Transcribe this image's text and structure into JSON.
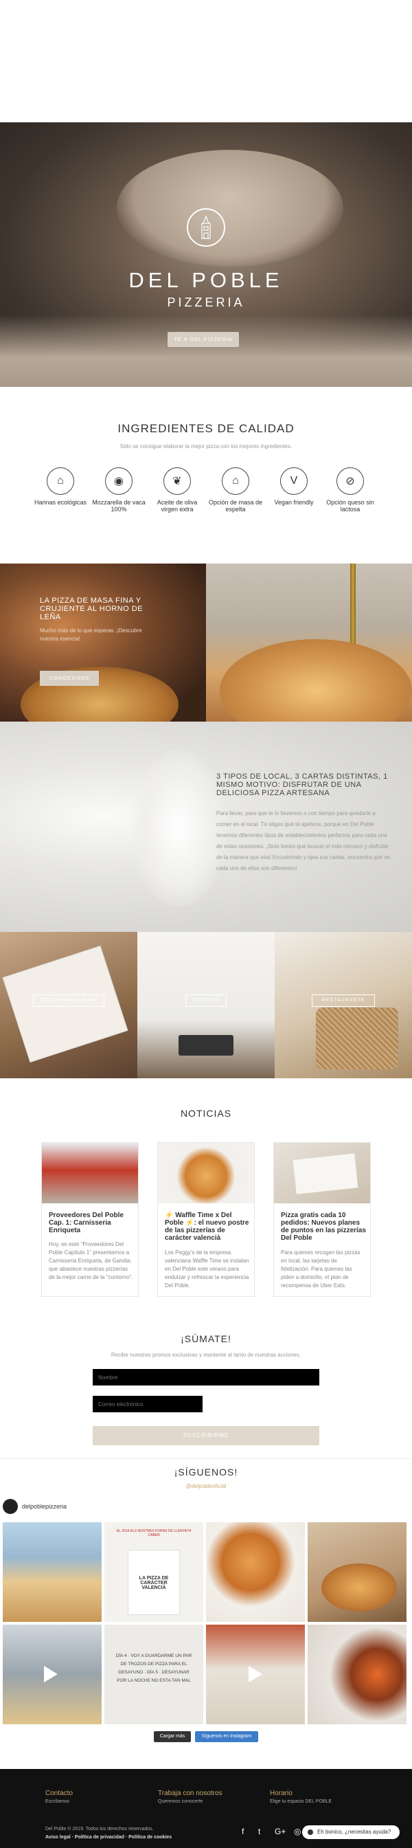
{
  "hero": {
    "brand_title": "DEL POBLE",
    "brand_subtitle": "PIZZERIA",
    "button": "TE A DEL PIZZERIA"
  },
  "ingredients": {
    "title": "INGREDIENTES DE CALIDAD",
    "subtitle": "Sólo se consigue elaborar la mejor pizza con los mejores ingredientes.",
    "items": [
      {
        "icon": "flour-sack-icon",
        "label": "Harinas ecológicas"
      },
      {
        "icon": "mozzarella-icon",
        "label": "Mozzarella de vaca 100%"
      },
      {
        "icon": "olive-icon",
        "label": "Aceite de oliva virgen extra"
      },
      {
        "icon": "spelt-dough-icon",
        "label": "Opción de masa de espelta"
      },
      {
        "icon": "vegan-icon",
        "label": "Vegan friendly"
      },
      {
        "icon": "lactose-free-icon",
        "label": "Opción queso sin lactosa"
      }
    ]
  },
  "thin": {
    "title": "LA PIZZA DE MASA FINA Y CRUJIENTE AL HORNO DE LEÑA",
    "text": "Mucho más de lo que esperas. ¡Descubre nuestra esencia!",
    "button": "CONÓCENOS"
  },
  "local": {
    "title": "3 TIPOS DE LOCAL, 3 CARTAS DISTINTAS, 1 MISMO MOTIVO: DISFRUTAR DE UNA DELICIOSA PIZZA ARTESANA",
    "text": "Para llevar, para que te lo llevemos o con tiempo para quedarte a comer en el local. Tú eliges qué te apetece, porque en Del Poble tenemos diferentes tipos de establecimientos perfectos para cada una de estas ocasiones. ¡Solo tienes que buscar el más cercano y disfrutar de la manera que sea! Encuéntralo y ojea sus cartas, encuentra qué en cada uno de ellos son diferentes!"
  },
  "types": [
    "SOLO PARA LLEVAR",
    "PIZZERÍA",
    "RESTAURANTE"
  ],
  "news": {
    "title": "NOTICIAS",
    "cards": [
      {
        "title": "Proveedores Del Poble Cap. 1: Carnisseria Enriqueta",
        "text": "Hoy, en este \"Proveedores Del Poble Capítulo 1\" presentamos a Carnisseria Enriqueta, de Gandia, que abastece nuestras pizzerías de la mejor carne de la \"contorno\"."
      },
      {
        "title": "⚡ Waffle Time x Del Poble ⚡: el nuevo postre de las pizzerías de carácter valencià",
        "text": "Los Peggy's de la empresa valenciana Waffle Time se instalan en Del Poble este verano para endulzar y refrescar la experiencia Del Poble."
      },
      {
        "title": "Pizza gratis cada 10 pedidos: Nuevos planes de puntos en las pizzerías Del Poble",
        "text": "Para quienes recogen las pizzas en local, las tarjetas de fidelización. Para quienes las piden a domicilio, el plan de recompensa de Uber Eats."
      }
    ]
  },
  "signup": {
    "title": "¡SÚMATE!",
    "subtitle": "Recibe nuestras promos exclusivas y mantente al tanto de nuestras acciones.",
    "name_placeholder": "Nombre",
    "email_placeholder": "Correo electrónico",
    "button": "SUSCRIBIRME"
  },
  "follow": {
    "title": "¡SÍGUENOS!",
    "handle": "@delpobleoficial",
    "account": "delpoblepizzeria",
    "post_text": "DÍA 4 · VOY A GUARDARME UN PAR DE TROZOS DE PIZZA PARA EL DESAYUNO · DÍA 5 · DESAYUNAR POR LA NOCHE NO ESTA TAN MAL",
    "promo_text": "EL 2014 ELS NOSTRES FORNS DE LLENYA HI CABEN",
    "bag_text": "LA PIZZA DE CARÁCTER VALENCIÀ",
    "load_more": "Cargar más",
    "follow_btn": "Síguenos en Instagram"
  },
  "footer": {
    "col1_title": "Contacto",
    "col1_text": "Escríbenos",
    "col2_title": "Trabaja con nosotros",
    "col2_text": "Queremos conocerte",
    "col3_title": "Horario",
    "col3_text": "Elige tu espacio DEL POBLE",
    "copyright": "Del Poble © 2019. Todos los derechos reservados.",
    "legal": "Aviso legal · Política de privacidad · Política de cookies",
    "whatsapp": "Eh bonico, ¿necesitas ayuda?"
  },
  "colors": {
    "accent": "#d8cfc4",
    "dark": "#111111",
    "gold": "#c8a96e"
  }
}
